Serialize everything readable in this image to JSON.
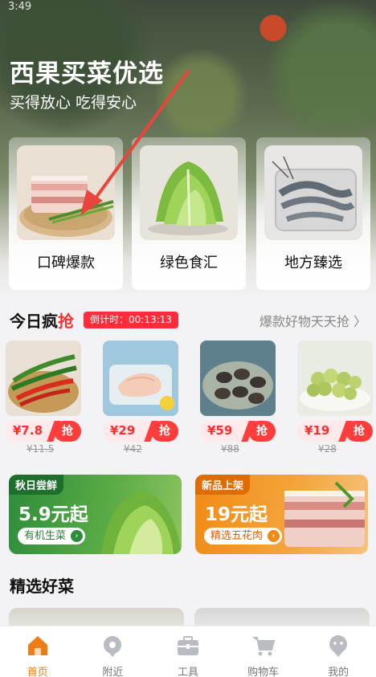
{
  "status": {
    "time": "3:49"
  },
  "hero": {
    "title": "西果买菜优选",
    "subtitle": "买得放心 吃得安心"
  },
  "categories": [
    {
      "label": "口碑爆款",
      "icon": "pork-belly-image"
    },
    {
      "label": "绿色食汇",
      "icon": "lettuce-image"
    },
    {
      "label": "地方臻选",
      "icon": "shrimp-image"
    }
  ],
  "flash_sale": {
    "title_prefix": "今日疯",
    "title_accent": "抢",
    "timer": "倒计时：00:13:13",
    "more": "爆款好物天天抢 〉",
    "grab_label": "抢",
    "items": [
      {
        "price": "¥7.8",
        "old_price": "¥11.5",
        "icon": "chili-image"
      },
      {
        "price": "¥29",
        "old_price": "¥42",
        "icon": "chicken-breast-image"
      },
      {
        "price": "¥59",
        "old_price": "¥88",
        "icon": "abalone-image"
      },
      {
        "price": "¥19",
        "old_price": "¥28",
        "icon": "grape-image"
      }
    ]
  },
  "promos": [
    {
      "tag": "秋日尝鲜",
      "headline": "5.9元起",
      "pill": "有机生菜"
    },
    {
      "tag": "新品上架",
      "headline": "19元起",
      "pill": "精选五花肉"
    }
  ],
  "featured": {
    "title": "精选好菜"
  },
  "tabs": [
    {
      "label": "首页",
      "icon": "home-icon",
      "active": true
    },
    {
      "label": "附近",
      "icon": "location-icon",
      "active": false
    },
    {
      "label": "工具",
      "icon": "toolbox-icon",
      "active": false
    },
    {
      "label": "购物车",
      "icon": "cart-icon",
      "active": false
    },
    {
      "label": "我的",
      "icon": "profile-icon",
      "active": false
    }
  ],
  "colors": {
    "accent": "#ff2d2d",
    "tab_active": "#f07c18",
    "green": "#2e8c3a",
    "orange": "#f08a16"
  }
}
